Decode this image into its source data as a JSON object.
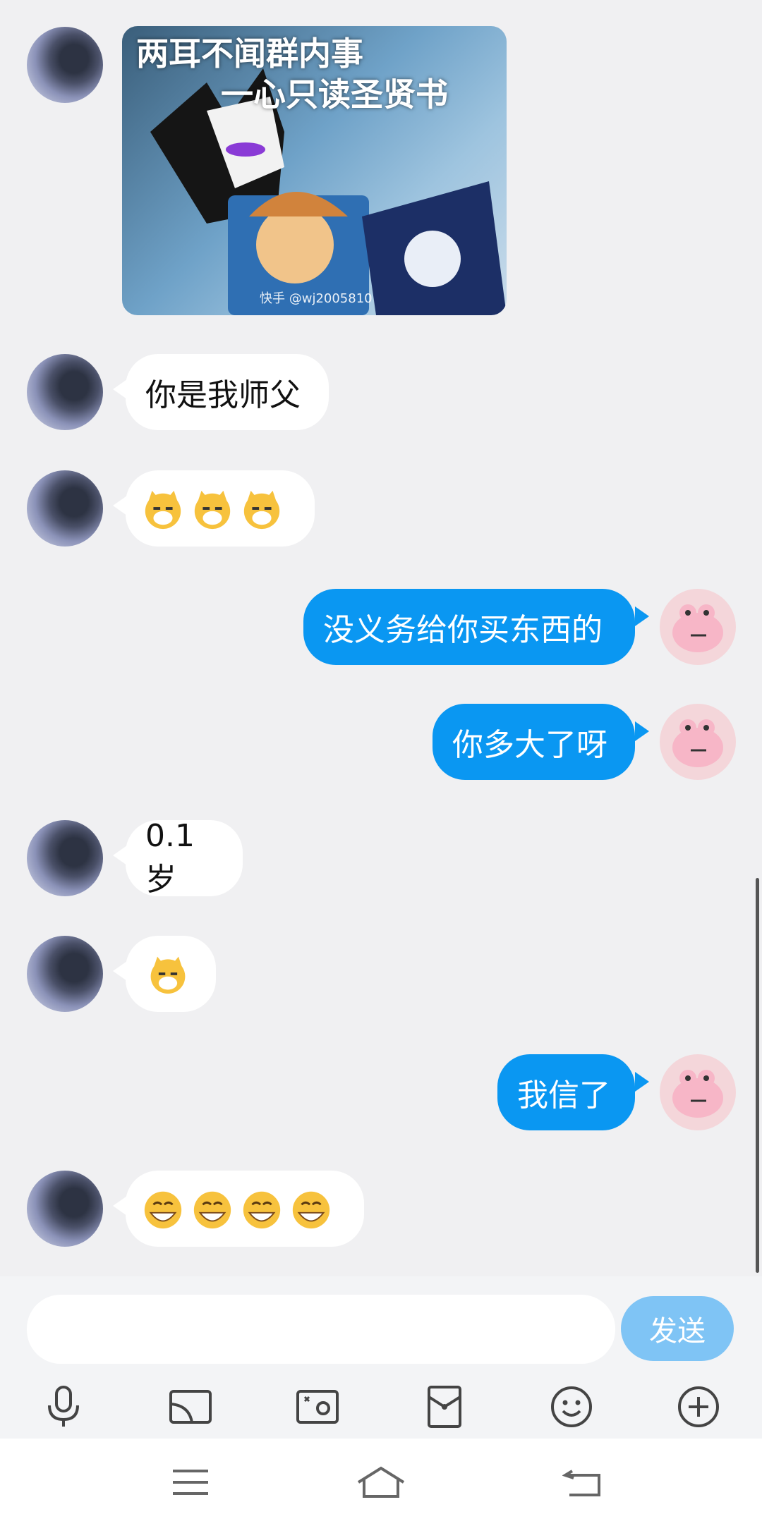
{
  "messages": [
    {
      "side": "left",
      "type": "image",
      "caption_line1": "两耳不闻群内事",
      "caption_line2": "一心只读圣贤书",
      "watermark": "快手 @wj2005810"
    },
    {
      "side": "left",
      "type": "text",
      "text": "你是我师父"
    },
    {
      "side": "left",
      "type": "emoji",
      "count": 3,
      "emoji": "cat-smirk-emoji"
    },
    {
      "side": "right",
      "type": "text",
      "text": "没义务给你买东西的"
    },
    {
      "side": "right",
      "type": "text",
      "text": "你多大了呀"
    },
    {
      "side": "left",
      "type": "text",
      "text": "0.1岁"
    },
    {
      "side": "left",
      "type": "emoji",
      "count": 1,
      "emoji": "cat-smirk-emoji"
    },
    {
      "side": "right",
      "type": "text",
      "text": "我信了"
    },
    {
      "side": "left",
      "type": "emoji",
      "count": 4,
      "emoji": "grin-emoji"
    }
  ],
  "composer": {
    "placeholder": "",
    "send_label": "发送"
  },
  "toolbar": [
    "microphone-icon",
    "screen-icon",
    "photo-icon",
    "red-packet-icon",
    "smiley-icon",
    "plus-icon"
  ],
  "navigation": [
    "menu-icon",
    "home-icon",
    "back-icon"
  ],
  "colors": {
    "accent": "#0a97f2",
    "send_disabled": "#7fc4f5",
    "background": "#f0f0f2"
  }
}
